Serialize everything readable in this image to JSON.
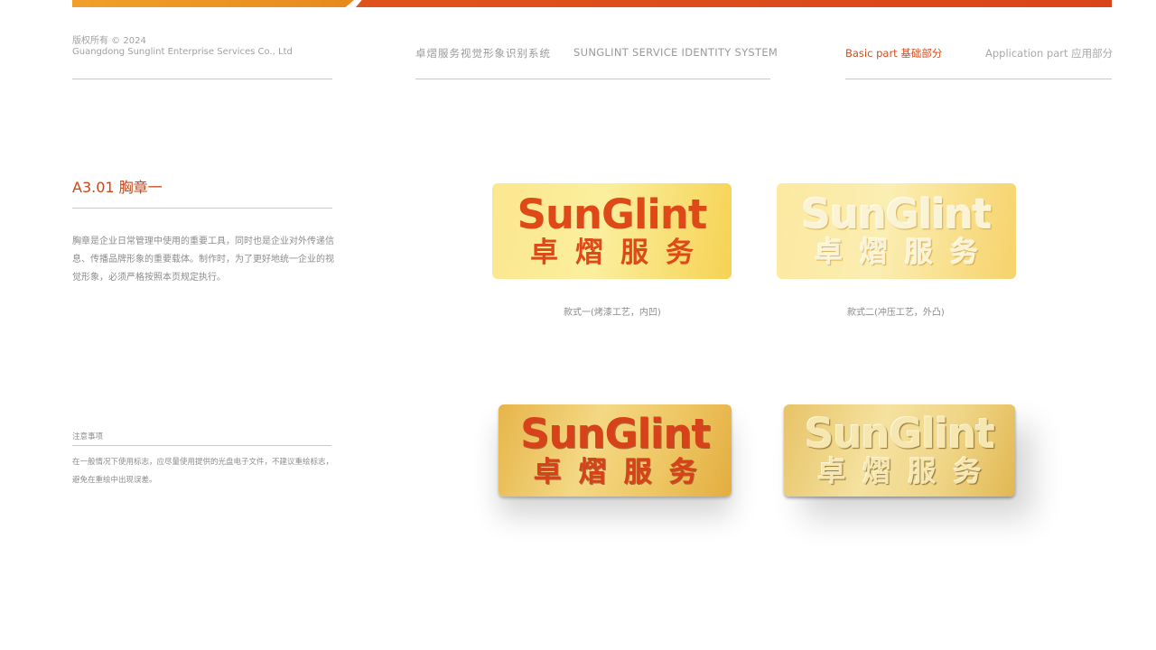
{
  "header": {
    "copyright_line1": "版权所有 © 2024",
    "copyright_line2": "Guangdong Sunglint Enterprise Services Co., Ltd",
    "system_title_cn": "卓熠服务视觉形象识别系统",
    "system_title_en": "SUNGLINT SERVICE IDENTITY SYSTEM",
    "nav": [
      {
        "label": "Basic part 基础部分",
        "active": true
      },
      {
        "label": "Application part 应用部分",
        "active": false
      }
    ]
  },
  "section": {
    "title": "A3.01 胸章一",
    "description": "胸章是企业日常管理中使用的重要工具，同时也是企业对外传递信息、传播品牌形象的重要载体。制作时，为了更好地统一企业的视觉形象，必须严格按照本页规定执行。",
    "note_title": "注意事项",
    "note_text": "在一般情况下使用标志，应尽量使用提供的光盘电子文件，不建议重绘标志，避免在重绘中出现误差。"
  },
  "badges": [
    {
      "logo_en": "SunGlint",
      "logo_cn": "卓熠服务",
      "caption": "款式一(烤漆工艺，内凹)"
    },
    {
      "logo_en": "SunGlint",
      "logo_cn": "卓熠服务",
      "caption": "款式二(冲压工艺，外凸)"
    },
    {
      "logo_en": "SunGlint",
      "logo_cn": "卓熠服务"
    },
    {
      "logo_en": "SunGlint",
      "logo_cn": "卓熠服务"
    }
  ],
  "colors": {
    "accent": "#d14d1c",
    "bar_orange": "#f0a02a",
    "bar_red": "#dd4e1b",
    "badge_gold": "#f6d253"
  }
}
